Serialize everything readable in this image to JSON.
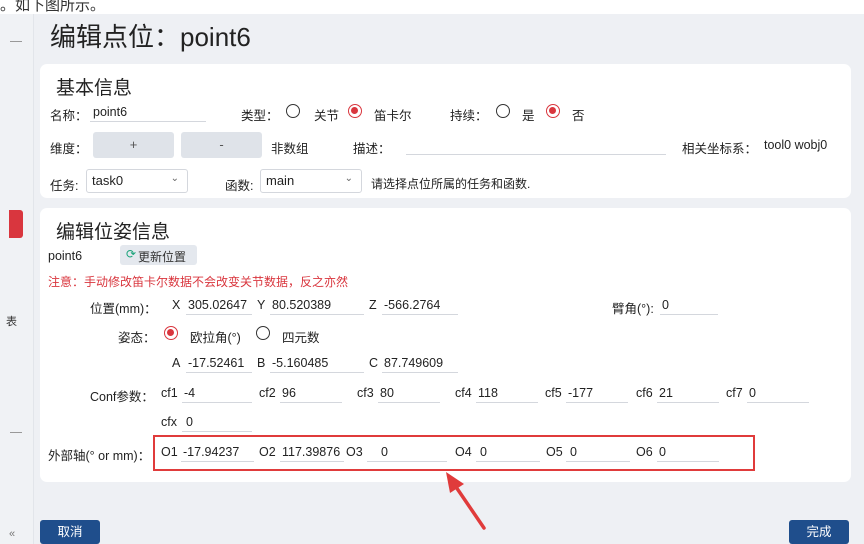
{
  "top_fragment": "。如下图所示。",
  "sidebar": {
    "side_char": "表",
    "collapse": "«"
  },
  "page_title": "编辑点位：point6",
  "basic": {
    "title": "基本信息",
    "name_label": "名称：",
    "name_value": "point6",
    "type_label": "类型：",
    "type_options": [
      "关节",
      "笛卡尔"
    ],
    "type_selected": "笛卡尔",
    "continuous_label": "持续：",
    "continuous_options": [
      "是",
      "否"
    ],
    "continuous_selected": "否",
    "dimension_label": "维度：",
    "plus": "+",
    "minus": "-",
    "non_array": "非数组",
    "desc_label": "描述：",
    "desc_value": "",
    "coords_label": "相关坐标系：",
    "coords_value": "tool0 wobj0",
    "task_label": "任务:",
    "task_value": "task0",
    "func_label": "函数:",
    "func_value": "main",
    "hint": "请选择点位所属的任务和函数."
  },
  "pose": {
    "title": "编辑位姿信息",
    "point_name": "point6",
    "update_button": "更新位置",
    "warning": "注意：手动修改笛卡尔数据不会改变关节数据，反之亦然",
    "position_label": "位置(mm)：",
    "x_label": "X",
    "x_value": "305.02647",
    "y_label": "Y",
    "y_value": "80.520389",
    "z_label": "Z",
    "z_value": "-566.2764",
    "arm_angle_label": "臂角(°):",
    "arm_angle_value": "0",
    "attitude_label": "姿态：",
    "attitude_options": [
      "欧拉角(°)",
      "四元数"
    ],
    "attitude_selected": "欧拉角(°)",
    "a_label": "A",
    "a_value": "-17.52461",
    "b_label": "B",
    "b_value": "-5.160485",
    "c_label": "C",
    "c_value": "87.749609",
    "conf_label": "Conf参数：",
    "conf": [
      {
        "label": "cf1",
        "value": "-4"
      },
      {
        "label": "cf2",
        "value": "96"
      },
      {
        "label": "cf3",
        "value": "80"
      },
      {
        "label": "cf4",
        "value": "118"
      },
      {
        "label": "cf5",
        "value": "-177"
      },
      {
        "label": "cf6",
        "value": "21"
      },
      {
        "label": "cf7",
        "value": "0"
      }
    ],
    "cfx_label": "cfx",
    "cfx_value": "0",
    "ext_label": "外部轴(° or mm)：",
    "ext": [
      {
        "label": "O1",
        "value": "-17.94237"
      },
      {
        "label": "O2",
        "value": "117.39876"
      },
      {
        "label": "O3",
        "value": "0"
      },
      {
        "label": "O4",
        "value": "0"
      },
      {
        "label": "O5",
        "value": "0"
      },
      {
        "label": "O6",
        "value": "0"
      }
    ]
  },
  "footer": {
    "cancel": "取消",
    "done": "完成"
  },
  "colors": {
    "accent": "#d9363e",
    "primary_button": "#1f4e8c",
    "annotation": "#e03b3b",
    "refresh_icon": "#1aa37a"
  }
}
